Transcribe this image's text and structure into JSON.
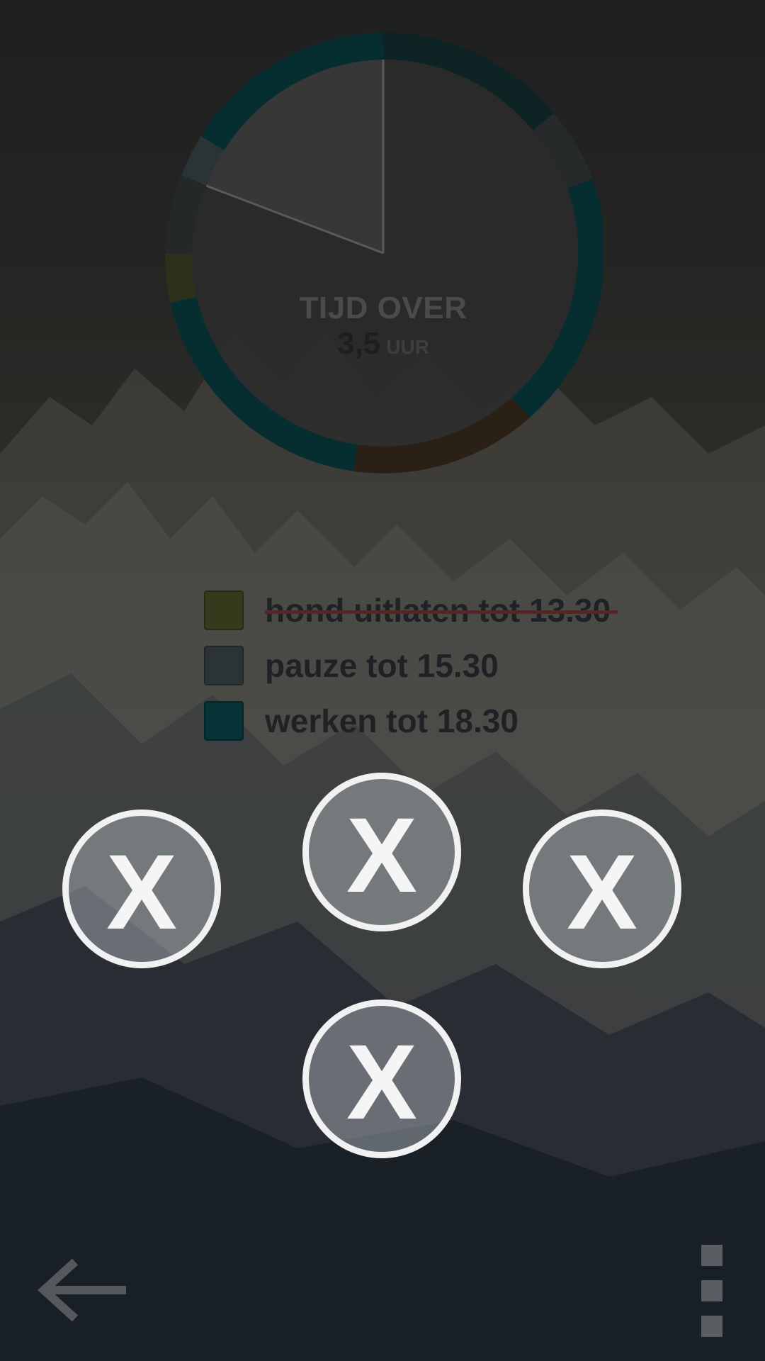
{
  "chart_data": {
    "type": "pie",
    "center": {
      "title": "TIJD OVER",
      "value": "3,5",
      "unit": "UUR"
    },
    "ring_colors": {
      "dog": "#2d311b",
      "pause": "#2a3336",
      "work": "#062d30",
      "brown": "#2a2016"
    }
  },
  "legend": {
    "items": [
      {
        "label": "hond uitlaten tot 13.30",
        "color": "#353a1d",
        "completed": true
      },
      {
        "label": "pauze tot 15.30",
        "color": "#2c3336",
        "completed": false
      },
      {
        "label": "werken tot 18.30",
        "color": "#063235",
        "completed": false
      }
    ]
  },
  "buttons": {
    "x_left": "X",
    "x_top": "X",
    "x_right": "X",
    "x_bottom": "X"
  },
  "nav": {
    "back_icon": "arrow-left-icon",
    "menu_icon": "overflow-menu-icon"
  }
}
